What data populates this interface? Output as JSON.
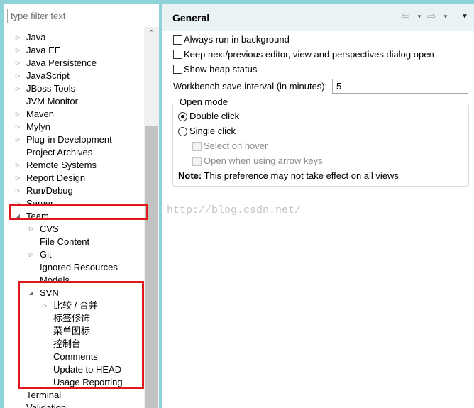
{
  "filter": {
    "placeholder": "type filter text",
    "value": ""
  },
  "tree": {
    "items": [
      {
        "label": "Java",
        "twisty": "▷"
      },
      {
        "label": "Java EE",
        "twisty": "▷"
      },
      {
        "label": "Java Persistence",
        "twisty": "▷"
      },
      {
        "label": "JavaScript",
        "twisty": "▷"
      },
      {
        "label": "JBoss Tools",
        "twisty": "▷"
      },
      {
        "label": "JVM Monitor",
        "twisty": ""
      },
      {
        "label": "Maven",
        "twisty": "▷"
      },
      {
        "label": "Mylyn",
        "twisty": "▷"
      },
      {
        "label": "Plug-in Development",
        "twisty": "▷"
      },
      {
        "label": "Project Archives",
        "twisty": ""
      },
      {
        "label": "Remote Systems",
        "twisty": "▷"
      },
      {
        "label": "Report Design",
        "twisty": "▷"
      },
      {
        "label": "Run/Debug",
        "twisty": "▷"
      },
      {
        "label": "Server",
        "twisty": "▷"
      },
      {
        "label": "Team",
        "twisty": "◢"
      },
      {
        "label": "CVS",
        "twisty": "▷"
      },
      {
        "label": "File Content",
        "twisty": ""
      },
      {
        "label": "Git",
        "twisty": "▷"
      },
      {
        "label": "Ignored Resources",
        "twisty": ""
      },
      {
        "label": "Models",
        "twisty": ""
      },
      {
        "label": "SVN",
        "twisty": "◢"
      },
      {
        "label": "比较 / 合并",
        "twisty": "▷"
      },
      {
        "label": "标签修饰",
        "twisty": ""
      },
      {
        "label": "菜单图标",
        "twisty": ""
      },
      {
        "label": "控制台",
        "twisty": ""
      },
      {
        "label": "Comments",
        "twisty": ""
      },
      {
        "label": "Update to HEAD",
        "twisty": ""
      },
      {
        "label": "Usage Reporting",
        "twisty": ""
      },
      {
        "label": "Terminal",
        "twisty": ""
      },
      {
        "label": "Validation",
        "twisty": ""
      }
    ]
  },
  "page": {
    "title": "General",
    "back_icon": "⇦",
    "forward_icon": "⇨",
    "dropdown_icon": "▼",
    "menu_icon": "▼"
  },
  "options": {
    "always_run": "Always run in background",
    "keep_next_prev": "Keep next/previous editor, view and perspectives dialog open",
    "show_heap": "Show heap status",
    "save_interval_label": "Workbench save interval (in minutes):",
    "save_interval_value": "5"
  },
  "open_mode": {
    "legend": "Open mode",
    "double_click": "Double click",
    "single_click": "Single click",
    "select_on_hover": "Select on hover",
    "open_with_arrow": "Open when using arrow keys",
    "note_label": "Note:",
    "note_text": " This preference may not take effect on all views"
  },
  "watermark": "http://blog.csdn.net/",
  "colors": {
    "highlight": "#e0161b",
    "header_bg": "#eaf3f4",
    "window_bg": "#8fd3d8"
  }
}
